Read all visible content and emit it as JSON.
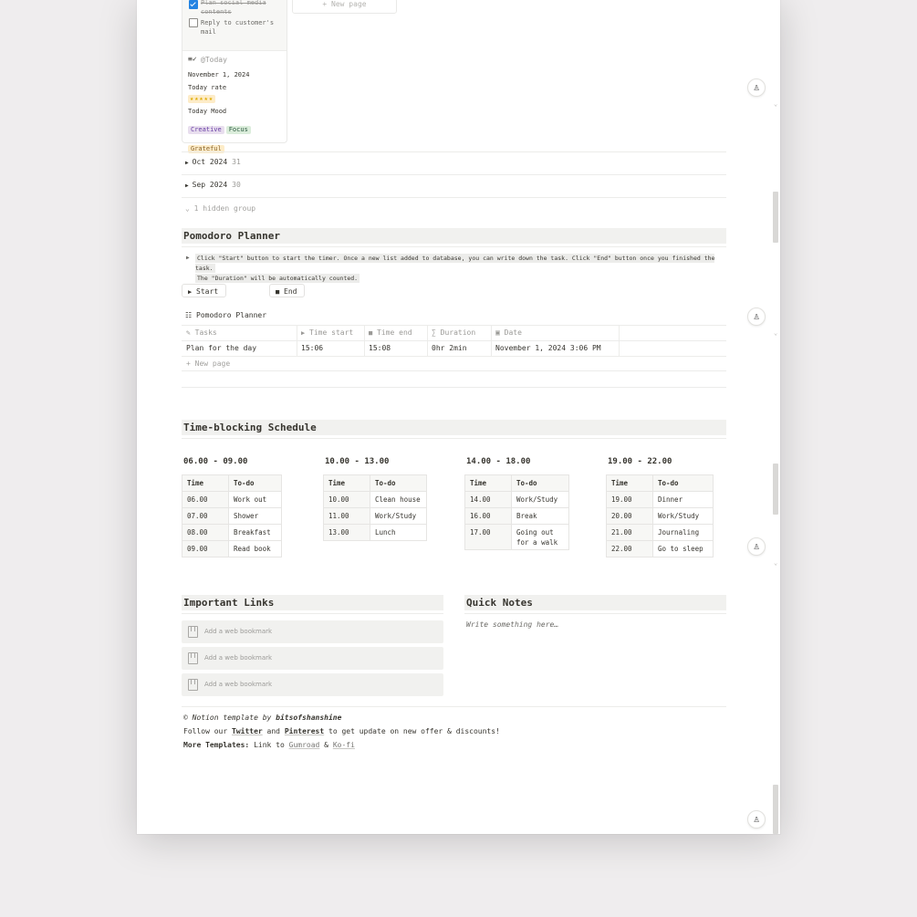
{
  "board_card": {
    "tasks": [
      {
        "label": "Plan social media contents",
        "line1": "Plan social media",
        "line2": "contents",
        "done": true
      },
      {
        "label": "Reply to customer's mail",
        "line1": "Reply to customer's",
        "line2": "mail",
        "done": false
      }
    ],
    "date_mention": "@Today",
    "date": "November 1, 2024",
    "rate_label": "Today rate",
    "rate_stars": "★★★★★",
    "mood_label": "Today Mood",
    "moods": [
      {
        "label": "Creative",
        "bg": "#e8deee",
        "color": "#6940a5"
      },
      {
        "label": "Focus",
        "bg": "#dbeddb",
        "color": "#2b593f"
      },
      {
        "label": "Grateful",
        "bg": "#fdecc8",
        "color": "#89632a"
      }
    ]
  },
  "board_new_page": "+ New page",
  "groups": [
    {
      "label": "Oct 2024",
      "count": "31"
    },
    {
      "label": "Sep 2024",
      "count": "30"
    }
  ],
  "hidden_group": "1 hidden group",
  "pomodoro": {
    "heading": "Pomodoro Planner",
    "instruction_line1": "Click \"Start\" button to start the timer. Once a new list added to database, you can write down the task. Click \"End\" button once you finished the task.",
    "instruction_line2": "The \"Duration\" will be automatically counted.",
    "start_label": "Start",
    "end_label": "End",
    "db_title": "Pomodoro Planner",
    "columns": [
      "Tasks",
      "Time start",
      "Time end",
      "Duration",
      "Date"
    ],
    "rows": [
      {
        "task": "Plan for the day",
        "start": "15:06",
        "end": "15:08",
        "duration": "0hr 2min",
        "date": "November 1, 2024 3:06 PM"
      }
    ],
    "new_page": "+ New page"
  },
  "timeblock": {
    "heading": "Time-blocking Schedule",
    "col_time": "Time",
    "col_todo": "To-do",
    "blocks": [
      {
        "title": "06.00 - 09.00",
        "rows": [
          [
            "06.00",
            "Work out"
          ],
          [
            "07.00",
            "Shower"
          ],
          [
            "08.00",
            "Breakfast"
          ],
          [
            "09.00",
            "Read book"
          ]
        ]
      },
      {
        "title": "10.00 - 13.00",
        "rows": [
          [
            "10.00",
            "Clean house"
          ],
          [
            "11.00",
            "Work/Study"
          ],
          [
            "13.00",
            "Lunch"
          ]
        ]
      },
      {
        "title": "14.00 - 18.00",
        "rows": [
          [
            "14.00",
            "Work/Study"
          ],
          [
            "16.00",
            "Break"
          ],
          [
            "17.00",
            "Going out for a walk"
          ]
        ]
      },
      {
        "title": "19.00 - 22.00",
        "rows": [
          [
            "19.00",
            "Dinner"
          ],
          [
            "20.00",
            "Work/Study"
          ],
          [
            "21.00",
            "Journaling"
          ],
          [
            "22.00",
            "Go to sleep"
          ]
        ]
      }
    ]
  },
  "links": {
    "heading": "Important Links",
    "bookmark_label": "Add a web bookmark",
    "bookmarks": [
      "Add a web bookmark",
      "Add a web bookmark",
      "Add a web bookmark"
    ]
  },
  "notes": {
    "heading": "Quick Notes",
    "placeholder": "Write something here…"
  },
  "footer": {
    "copyright_prefix": "© Notion template by",
    "author": "bitsofshanshine",
    "follow_prefix": "Follow our",
    "twitter": "Twitter",
    "and": "and",
    "pinterest": "Pinterest",
    "follow_suffix": "to get update on new offer & discounts!",
    "more_label": "More Templates:",
    "link_to": "Link to",
    "gumroad": "Gumroad",
    "amp": "&",
    "kofi": "Ko-fi"
  },
  "icons": {
    "side": "sparkle-person-icon",
    "checkbox": "checkbox-icon",
    "bookmark": "bookmark-icon"
  }
}
